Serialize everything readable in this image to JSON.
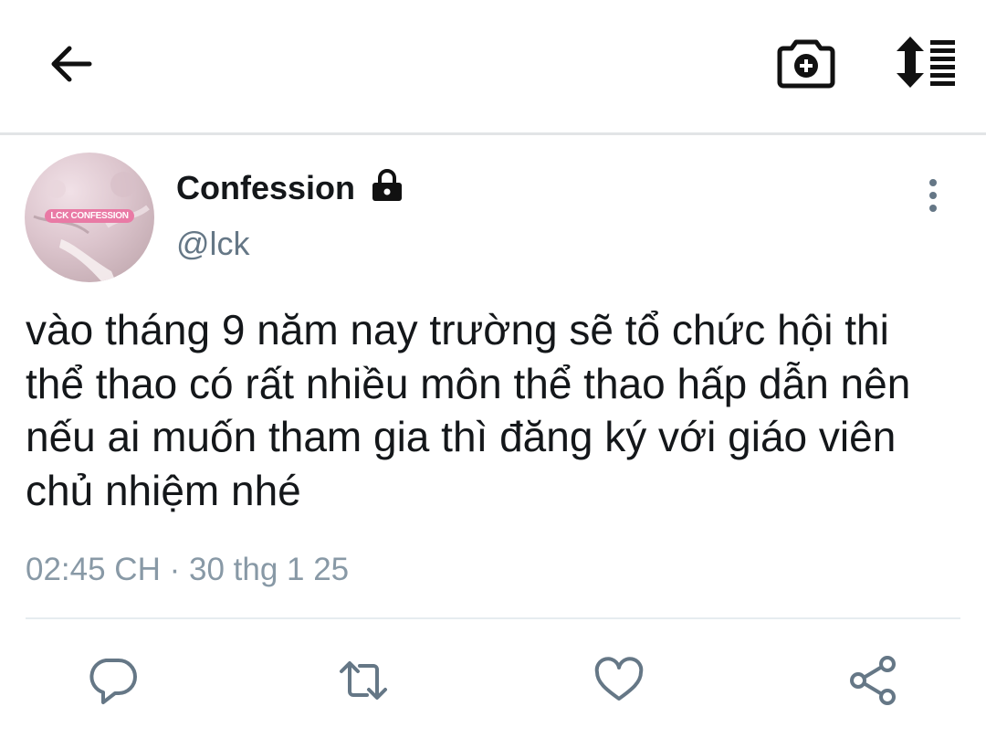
{
  "header": {
    "icons": [
      "back-arrow-icon",
      "add-photo-camera-icon",
      "sort-list-icon"
    ]
  },
  "tweet": {
    "avatar_badge": "LCK CONFESSION",
    "display_name": "Confession",
    "protected_icon": "lock-icon",
    "handle": "@lck",
    "text": "vào tháng 9 năm nay trường sẽ tổ chức hội thi\nthể thao có rất nhiều môn thể thao hấp dẫn nên\nnếu ai muốn tham gia thì đăng ký với giáo viên\nchủ nhiệm nhé",
    "time": "02:45 CH",
    "separator": " · ",
    "date": "30 thg 1 25"
  },
  "actions": [
    "reply-icon",
    "retweet-icon",
    "like-icon",
    "share-icon"
  ],
  "colors": {
    "text_primary": "#14171a",
    "text_secondary": "#657786",
    "meta_text": "#8899a6",
    "icon_blue": "#657786",
    "divider": "#e6ecf0"
  }
}
